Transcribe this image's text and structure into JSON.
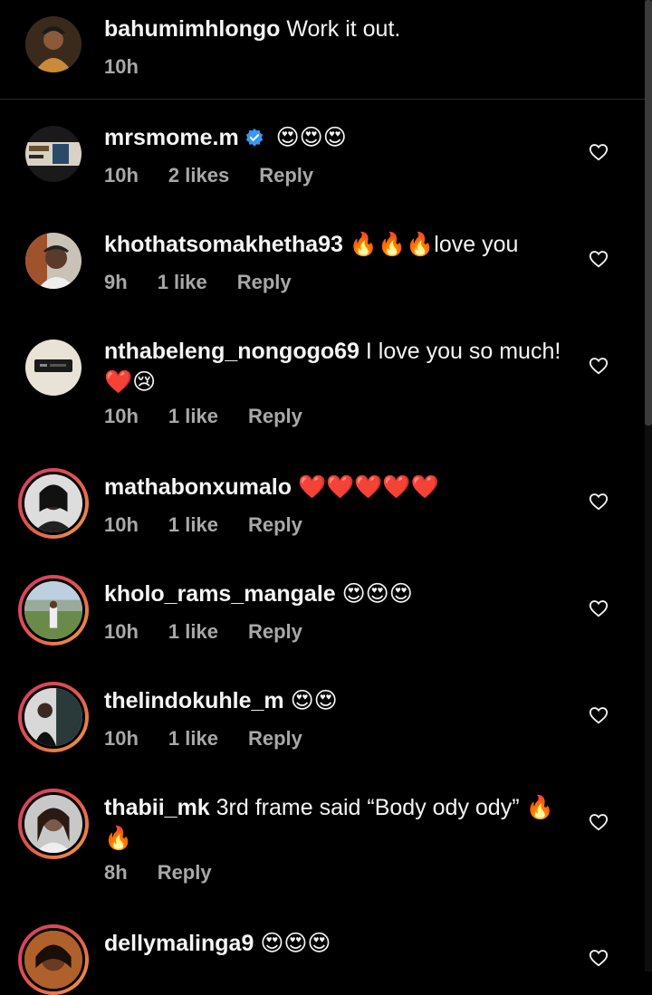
{
  "comments": [
    {
      "user": "bahumimhlongo",
      "text": "Work it out.",
      "time": "10h",
      "likes": "",
      "reply": ""
    },
    {
      "user": "mrsmome.m",
      "text": "😍😍😍",
      "time": "10h",
      "likes": "2 likes",
      "reply": "Reply"
    },
    {
      "user": "khothatsomakhetha93",
      "text": "🔥🔥🔥love you",
      "time": "9h",
      "likes": "1 like",
      "reply": "Reply"
    },
    {
      "user": "nthabeleng_nongogo69",
      "text": "I love you so much! ❤️😢",
      "time": "10h",
      "likes": "1 like",
      "reply": "Reply"
    },
    {
      "user": "mathabonxumalo",
      "text": "❤️❤️❤️❤️❤️",
      "time": "10h",
      "likes": "1 like",
      "reply": "Reply"
    },
    {
      "user": "kholo_rams_mangale",
      "text": "😍😍😍",
      "time": "10h",
      "likes": "1 like",
      "reply": "Reply"
    },
    {
      "user": "thelindokuhle_m",
      "text": "😍😍",
      "time": "10h",
      "likes": "1 like",
      "reply": "Reply"
    },
    {
      "user": "thabii_mk",
      "text": "3rd frame said “Body ody ody” 🔥🔥",
      "time": "8h",
      "likes": "",
      "reply": "Reply"
    },
    {
      "user": "dellymalinga9",
      "text": "😍😍😍",
      "time": "",
      "likes": "",
      "reply": ""
    }
  ],
  "colors": {
    "background": "#000000",
    "meta": "#a8a8a8",
    "verified": "#3897f0",
    "story_ring": "#e0524b"
  }
}
